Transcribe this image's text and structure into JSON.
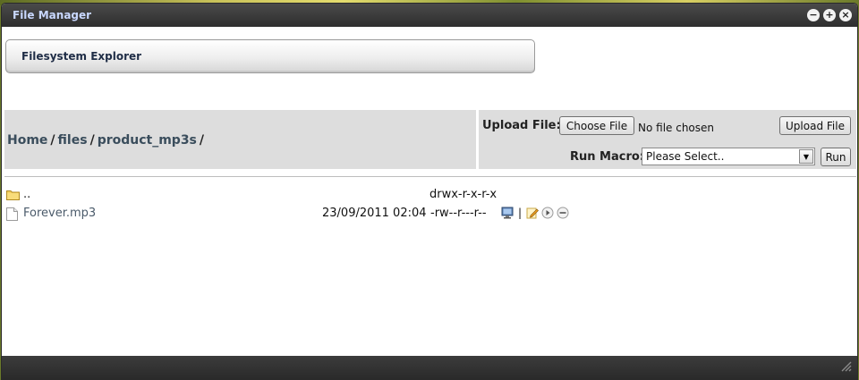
{
  "window": {
    "title": "File Manager",
    "controls": [
      {
        "icon": "minimize-icon",
        "glyph": "−"
      },
      {
        "icon": "maximize-icon",
        "glyph": "+"
      },
      {
        "icon": "close-icon",
        "glyph": "×"
      }
    ]
  },
  "tab": {
    "label": "Filesystem Explorer"
  },
  "breadcrumb": {
    "items": [
      "Home",
      "files",
      "product_mp3s"
    ],
    "separator": "/"
  },
  "upload": {
    "label": "Upload File:",
    "choose_label": "Choose File",
    "status": "No file chosen",
    "submit_label": "Upload File"
  },
  "macro": {
    "label": "Run Macro:",
    "selected": "Please Select..",
    "run_label": "Run"
  },
  "files": [
    {
      "name": "..",
      "type": "folder",
      "date": "",
      "permissions": "drwx-r-x-r-x"
    },
    {
      "name": "Forever.mp3",
      "type": "file",
      "date": "23/09/2011 02:04",
      "permissions": "-rw--r---r--"
    }
  ],
  "colors": {
    "titlebar": "#2e2e2e",
    "title_text": "#c9d8ff",
    "toolbar_bg": "#dddddd",
    "link": "#3a4d5c"
  }
}
